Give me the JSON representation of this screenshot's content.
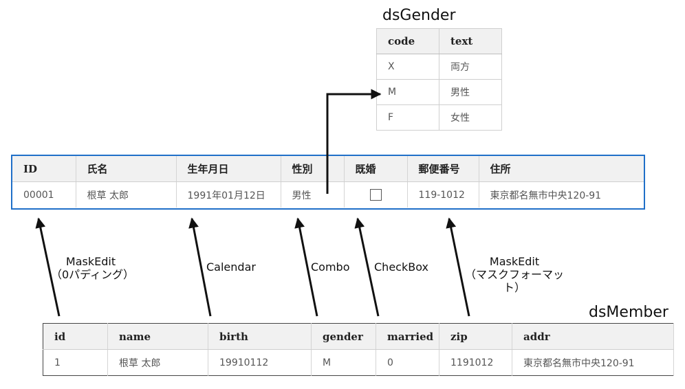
{
  "gender_ds": {
    "title": "dsGender",
    "columns": [
      "code",
      "text"
    ],
    "rows": [
      [
        "X",
        "両方"
      ],
      [
        "M",
        "男性"
      ],
      [
        "F",
        "女性"
      ]
    ]
  },
  "ui_grid": {
    "columns": [
      "ID",
      "氏名",
      "生年月日",
      "性別",
      "既婚",
      "郵便番号",
      "住所"
    ],
    "row": {
      "id": "00001",
      "name": "根草 太郎",
      "birth": "1991年01月12日",
      "gender": "男性",
      "married_checked": false,
      "zip": "119-1012",
      "addr": "東京都名無市中央120-91"
    }
  },
  "member_ds": {
    "title": "dsMember",
    "columns": [
      "id",
      "name",
      "birth",
      "gender",
      "married",
      "zip",
      "addr"
    ],
    "row": [
      "1",
      "根草 太郎",
      "19910112",
      "M",
      "0",
      "1191012",
      "東京都名無市中央120-91"
    ]
  },
  "annotations": {
    "maskedit_pad": "MaskEdit",
    "maskedit_pad_sub": "（0パディング）",
    "calendar": "Calendar",
    "combo": "Combo",
    "checkbox": "CheckBox",
    "maskedit_fmt": "MaskEdit",
    "maskedit_fmt_sub": "（マスクフォーマット）"
  }
}
